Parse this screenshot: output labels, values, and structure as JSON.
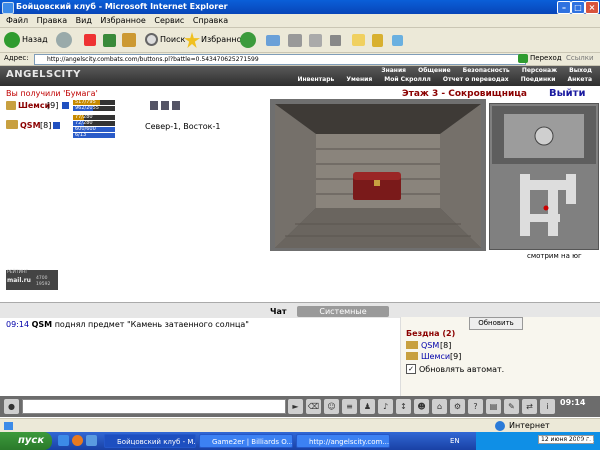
{
  "window": {
    "title": "Бойцовский клуб - Microsoft Internet Explorer"
  },
  "menu": [
    "Файл",
    "Правка",
    "Вид",
    "Избранное",
    "Сервис",
    "Справка"
  ],
  "toolbar": {
    "back": "Назад",
    "search": "Поиск",
    "favorites": "Избранное"
  },
  "address": {
    "label": "Адрес:",
    "url": "http://angelscity.combats.com/buttons.pl?battle=0.543470625271599",
    "go": "Переход",
    "links": "Ссылки"
  },
  "game": {
    "logo": "ANGELSCITY",
    "nav_top": [
      "Знания",
      "Общение",
      "Безопасность",
      "Персонаж",
      "Выход"
    ],
    "nav_bottom": [
      "Инвентарь",
      "Умения",
      "Мой Скроллл",
      "Отчет о переводах",
      "Поединки",
      "Анкета"
    ],
    "got_message": "Вы получили 'Бумага'",
    "room_title": "Этаж 3 - Сокровищница",
    "exit_label": "Выйти",
    "coords": "Север-1, Восток-1",
    "facing": "смотрим на юг",
    "players": [
      {
        "name": "Шемси",
        "level": "[9]",
        "hp_text": "517/795",
        "mana_text": "962/2055",
        "hp_fill": 0.65,
        "mana_fill": 0.47
      },
      {
        "name": "QSM",
        "level": "[8]",
        "hp_text": "77/280",
        "mana_text": "72/280",
        "hp2_text": "600/600",
        "mana2_text": "6/13",
        "hp_fill": 0.27,
        "mana_fill": 0.26
      }
    ],
    "counter": {
      "line1": "РЕЙТИНГ",
      "line2": "mail.ru",
      "n1": "4700",
      "n2": "19592"
    }
  },
  "chat": {
    "tabs": [
      "Чат",
      "Системные сообщения"
    ],
    "messages": [
      {
        "time": "09:14",
        "user": "QSM",
        "text": "поднял предмет \"Камень затаенного солнца\""
      }
    ]
  },
  "sidebox": {
    "refresh": "Обновить",
    "location": "Бездна (2)",
    "members": [
      {
        "name": "QSM",
        "level": "[8]"
      },
      {
        "name": "Шемси",
        "level": "[9]"
      }
    ],
    "auto": "Обновлять автомат."
  },
  "game_clock": "09:14",
  "statusbar": {
    "zone": "Интернет"
  },
  "taskbar": {
    "start": "пуск",
    "tasks": [
      "Бойцовский клуб - M...",
      "Game2er | Billiards O...",
      "http://angelscity.com..."
    ],
    "lang": "EN",
    "date": "12 июня 2009 г.",
    "time": "10:14"
  }
}
